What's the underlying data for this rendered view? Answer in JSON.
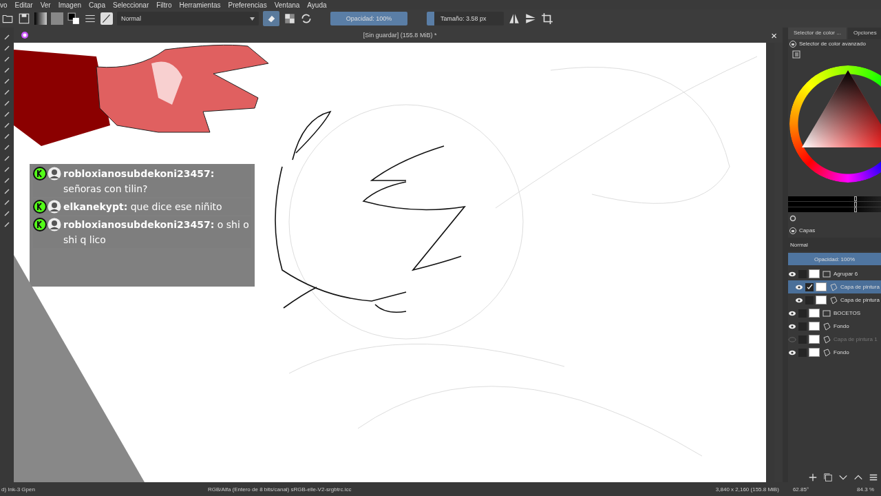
{
  "menu": [
    "vo",
    "Editar",
    "Ver",
    "Imagen",
    "Capa",
    "Seleccionar",
    "Filtro",
    "Herramientas",
    "Preferencias",
    "Ventana",
    "Ayuda"
  ],
  "toolbar": {
    "blend_mode": "Normal",
    "eraser_on": true,
    "opacity": {
      "label": "Opacidad: 100%",
      "level": 1
    },
    "size": {
      "label": "Tamaño: 3.58 px",
      "level": 0.1
    }
  },
  "document": {
    "title": "[Sin guardar] (155.8 MiB) *",
    "close": "×"
  },
  "chat": {
    "messages": [
      {
        "text": "**robloxianosubdekoni23457:** señoras con tilin?"
      },
      {
        "text": "**elkanekypt:** que dice ese niñito"
      },
      {
        "text": "**robloxianosubdekoni23457:** o shi o shi q lico"
      }
    ]
  },
  "docker": {
    "tabs": [
      {
        "label": "Selector de color ...",
        "selected": true
      },
      {
        "label": "Opciones",
        "selected": false
      }
    ],
    "color_selector": {
      "title": "Selector de color avanzado",
      "sliders": [
        {
          "level": 0.6
        },
        {
          "level": 0.6
        },
        {
          "level": 0.6
        }
      ]
    },
    "layers": {
      "title": "Capas",
      "blend_mode": "Normal",
      "opacity": {
        "label": "Opacidad:  100%",
        "level": 1
      },
      "items": [
        {
          "name": "Agrupar 6",
          "kind": "group",
          "visible": true,
          "selected": false,
          "children": [
            {
              "name": "Capa de pintura",
              "kind": "paint",
              "visible": true,
              "selected": true
            },
            {
              "name": "Capa de pintura",
              "kind": "paint",
              "visible": true,
              "selected": false
            }
          ]
        },
        {
          "name": "BOCETOS",
          "kind": "group",
          "visible": true,
          "selected": false
        },
        {
          "name": "Fondo",
          "kind": "paint",
          "visible": true,
          "selected": false
        },
        {
          "name": "Capa de pintura 1",
          "kind": "paint",
          "visible": false,
          "selected": false
        },
        {
          "name": "Fondo",
          "kind": "paint",
          "visible": true,
          "selected": false
        }
      ]
    }
  },
  "status_bar": {
    "brush": "d) Ink-3 Gpen",
    "color_space": "RGB/Alfa (Entero de 8 bits/canal)  sRGB-elle-V2-srgbtrc.icc",
    "dimensions": "3,840 x 2,160 (155.8 MiB)",
    "rotation": "62.85°",
    "zoom": "84.3 %"
  }
}
